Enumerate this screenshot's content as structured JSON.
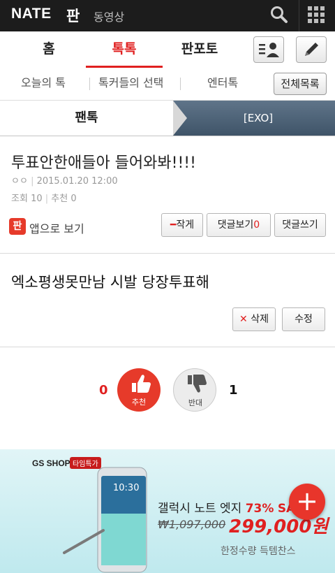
{
  "topbar": {
    "logo_text": "NATE",
    "logo_pan": "판",
    "video_label": "동영상",
    "search_icon": "search-icon",
    "menu_icon": "grid-menu-icon"
  },
  "nav": {
    "tabs": [
      {
        "label": "홈",
        "active": false
      },
      {
        "label": "톡톡",
        "active": true
      },
      {
        "label": "판포토",
        "active": false
      }
    ],
    "profile_icon": "profile-list-icon",
    "write_icon": "pencil-icon",
    "accent_color": "#e02020"
  },
  "subnav": {
    "items": [
      {
        "label": "오늘의 톡"
      },
      {
        "label": "톡커들의 선택"
      },
      {
        "label": "엔터톡"
      }
    ],
    "all_list_label": "전체목록"
  },
  "breadcrumb": {
    "left": "팬톡",
    "right": "[EXO]"
  },
  "post": {
    "title": "투표안한애들아 들어와봐!!!!",
    "author": "ㅇㅇ",
    "date": "2015.01.20 12:00",
    "views_label": "조회",
    "views": "10",
    "recommend_label": "추천",
    "recommend": "0",
    "body": "엑소평생못만남 시발 당장투표해"
  },
  "actions": {
    "app_icon_text": "판",
    "app_label": "앱으로 보기",
    "report_label": "작게",
    "comments_view_label": "댓글보기",
    "comments_count": "0",
    "comment_write_label": "댓글쓰기",
    "delete_label": "삭제",
    "edit_label": "수정"
  },
  "vote": {
    "up_count": "0",
    "up_label": "추천",
    "down_count": "1",
    "down_label": "반대"
  },
  "ad": {
    "brand": "GS SHOP",
    "tag": "타임특가",
    "model_prefix": "갤럭시 노트 엣지",
    "discount": "73%",
    "sale": "SA",
    "old_price": "₩1,097,000",
    "new_price": "299,000원",
    "limited": "한정수량 득템찬스",
    "phone_time": "10:30"
  },
  "fab": {
    "label": "+"
  }
}
